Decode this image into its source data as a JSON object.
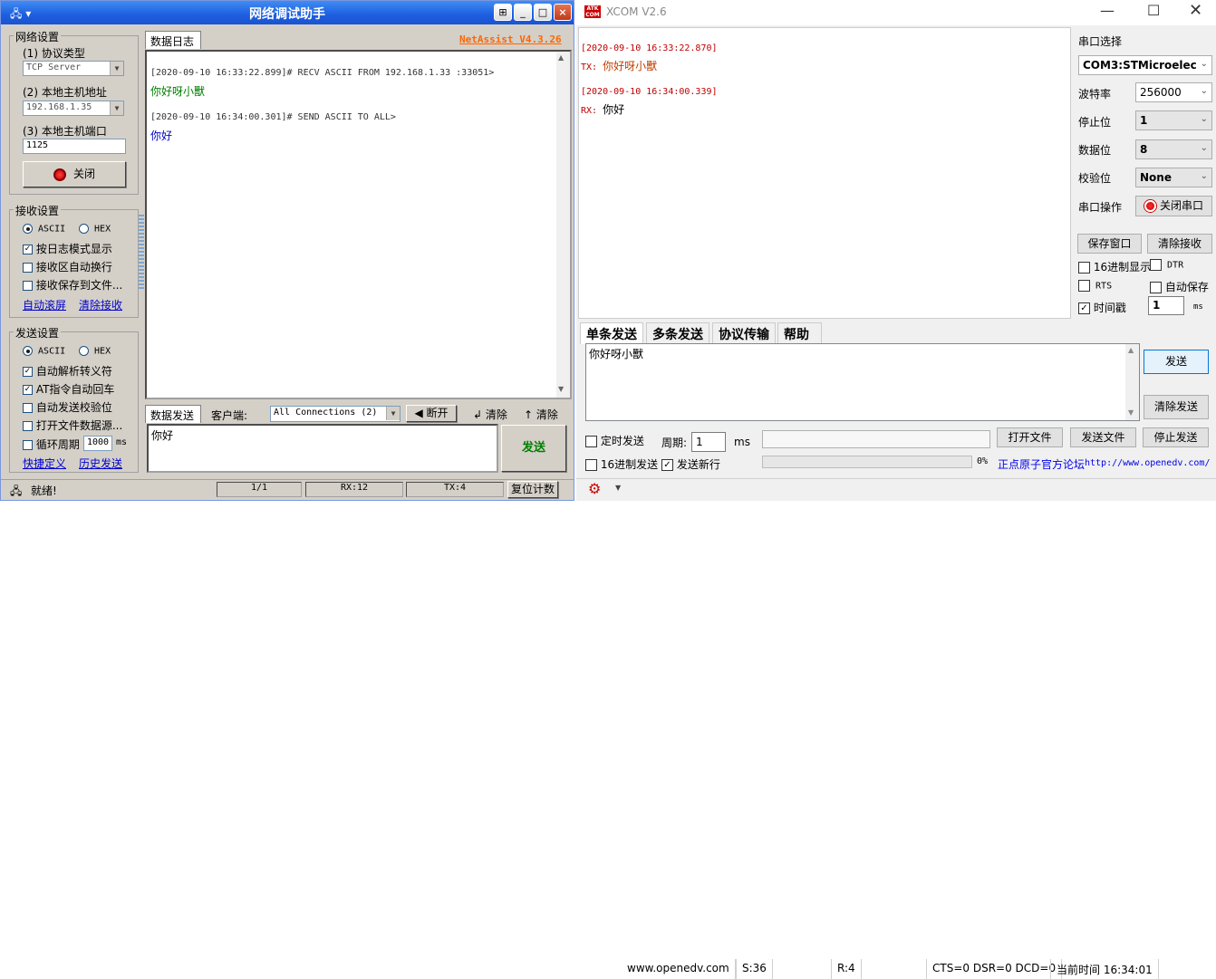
{
  "netassist": {
    "title": "网络调试助手",
    "version": "NetAssist V4.3.26",
    "net_group": {
      "title": "网络设置",
      "protocol_label": "(1) 协议类型",
      "protocol_value": "TCP Server",
      "host_label": "(2) 本地主机地址",
      "host_value": "192.168.1.35",
      "port_label": "(3) 本地主机端口",
      "port_value": "1125",
      "close_button": "关闭"
    },
    "recv_group": {
      "title": "接收设置",
      "ascii": "ASCII",
      "hex": "HEX",
      "opt_log": "按日志模式显示",
      "opt_wrap": "接收区自动换行",
      "opt_save": "接收保存到文件...",
      "link_scroll": "自动滚屏",
      "link_clear": "清除接收"
    },
    "send_group": {
      "title": "发送设置",
      "ascii": "ASCII",
      "hex": "HEX",
      "opt_escape": "自动解析转义符",
      "opt_at": "AT指令自动回车",
      "opt_check": "自动发送校验位",
      "opt_file": "打开文件数据源...",
      "opt_cycle": "循环周期",
      "cycle_value": "1000",
      "cycle_unit": "ms",
      "link_shortcut": "快捷定义",
      "link_history": "历史发送"
    },
    "log_tab": "数据日志",
    "log": [
      {
        "header": "[2020-09-10 16:33:22.899]# RECV ASCII FROM 192.168.1.33 :33051>",
        "body": "你好呀小獸",
        "color": "#008000"
      },
      {
        "header": "[2020-09-10 16:34:00.301]# SEND ASCII TO ALL>",
        "body": "你好",
        "color": "#0000cc"
      }
    ],
    "send_tab": "数据发送",
    "client_label": "客户端:",
    "client_value": "All Connections (2)",
    "disconnect": "断开",
    "clear1": "清除",
    "clear2": "清除",
    "send_text": "你好",
    "send_button": "发送",
    "status": {
      "ready": "就绪!",
      "page": "1/1",
      "rx": "RX:12",
      "tx": "TX:4",
      "reset": "复位计数"
    }
  },
  "xcom": {
    "title": "XCOM V2.6",
    "log": [
      {
        "header": "[2020-09-10 16:33:22.870]",
        "prefix": "TX: ",
        "body": "你好呀小獸",
        "body_color": "#c04000"
      },
      {
        "header": "[2020-09-10 16:34:00.339]",
        "prefix": "RX: ",
        "body": "你好",
        "body_color": "#000000"
      }
    ],
    "port_select_label": "串口选择",
    "port_value": "COM3:STMicroelec",
    "baud_label": "波特率",
    "baud_value": "256000",
    "stop_label": "停止位",
    "stop_value": "1",
    "data_label": "数据位",
    "data_value": "8",
    "parity_label": "校验位",
    "parity_value": "None",
    "op_label": "串口操作",
    "close_port": "关闭串口",
    "save_window": "保存窗口",
    "clear_recv": "清除接收",
    "hex_display": "16进制显示",
    "dtr": "DTR",
    "rts": "RTS",
    "auto_save": "自动保存",
    "timestamp": "时间戳",
    "timestamp_value": "1",
    "ms": "ms",
    "tabs": [
      "单条发送",
      "多条发送",
      "协议传输",
      "帮助"
    ],
    "send_text": "你好呀小獸",
    "send_button": "发送",
    "clear_send": "清除发送",
    "timed_send": "定时发送",
    "period_label": "周期:",
    "period_value": "1",
    "period_unit": "ms",
    "open_file": "打开文件",
    "send_file": "发送文件",
    "stop_send": "停止发送",
    "hex_send": "16进制发送",
    "send_newline": "发送新行",
    "progress": "0%",
    "forum_label": "正点原子官方论坛",
    "forum_url": "http://www.openedv.com/",
    "status": {
      "url": "www.openedv.com",
      "s": "S:36",
      "r": "R:4",
      "lines": "CTS=0 DSR=0 DCD=0",
      "time": "当前时间 16:34:01"
    }
  }
}
